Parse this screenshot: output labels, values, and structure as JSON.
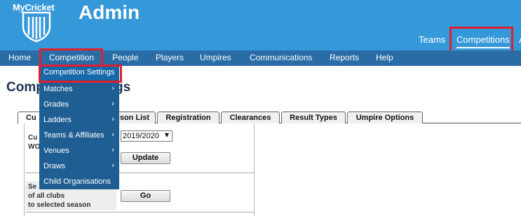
{
  "header": {
    "logo_text": "MyCricket",
    "title": "Admin",
    "links": [
      "Teams",
      "Competitions",
      "A"
    ],
    "highlight_color": "#e02030",
    "bar_color": "#3598d9"
  },
  "menu": {
    "items": [
      "Home",
      "Competition",
      "People",
      "Players",
      "Umpires",
      "Communications",
      "Reports",
      "Help"
    ]
  },
  "dropdown": {
    "items": [
      {
        "label": "Competition Settings",
        "submenu": false
      },
      {
        "label": "Matches",
        "submenu": true
      },
      {
        "label": "Grades",
        "submenu": true
      },
      {
        "label": "Ladders",
        "submenu": true
      },
      {
        "label": "Teams & Affiliates",
        "submenu": true
      },
      {
        "label": "Venues",
        "submenu": true
      },
      {
        "label": "Draws",
        "submenu": true
      },
      {
        "label": "Child Organisations",
        "submenu": false
      }
    ],
    "arrow": "›"
  },
  "page": {
    "heading_left": "Comp",
    "heading_right": "gs"
  },
  "tabs": [
    "Cu",
    "son List",
    "Registration",
    "Clearances",
    "Result Types",
    "Umpire Options"
  ],
  "form": {
    "row1_label_lines": [
      "Cu",
      "WO"
    ],
    "season_value": "2019/2020",
    "caret": "▼",
    "update_label": "Update",
    "row2_label_lines": [
      "Se",
      "of all clubs",
      "to selected season"
    ],
    "go_label": "Go"
  }
}
